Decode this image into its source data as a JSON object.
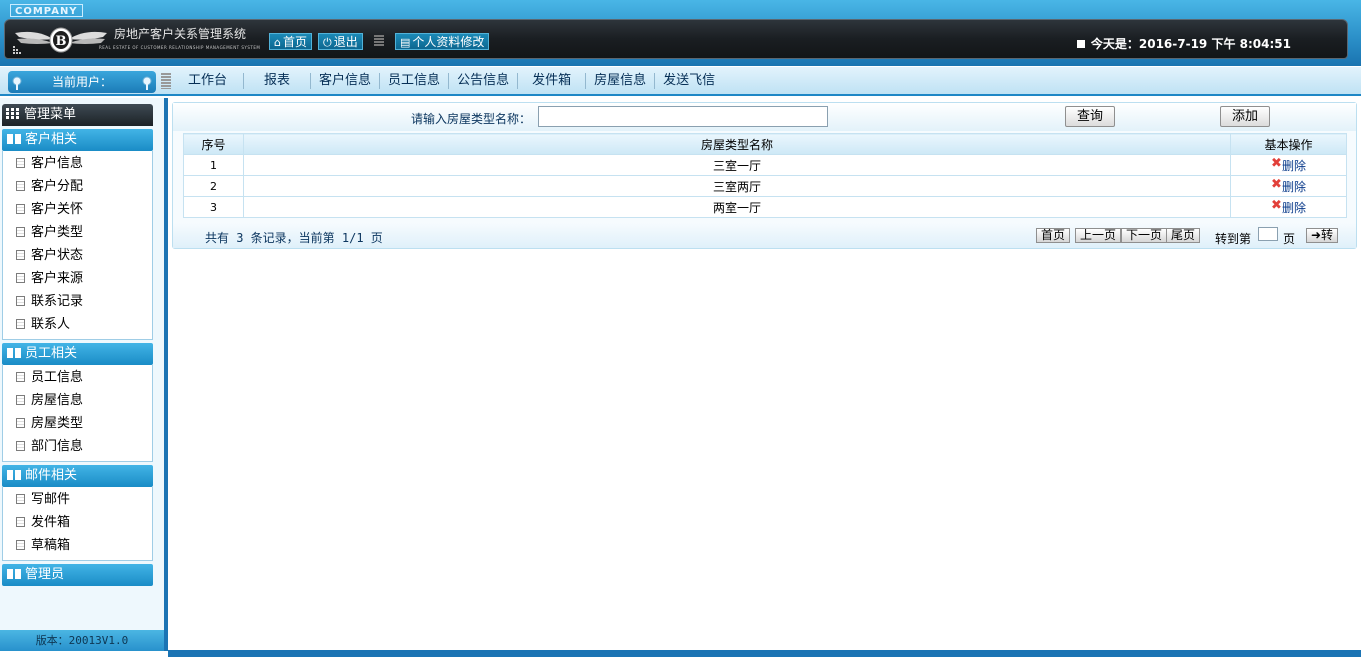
{
  "header": {
    "company_tag": "COMPANY",
    "system_title": "房地产客户关系管理系统",
    "system_subtitle": "REAL ESTATE OF CUSTOMER RELATIONSHIP MANAGEMENT SYSTEM",
    "home_label": "首页",
    "logout_label": "退出",
    "profile_label": "个人资料修改",
    "date_text": "今天是：2016-7-19 下午 8:04:51",
    "icons": {
      "home": "home-icon",
      "logout": "power-icon",
      "profile": "document-icon"
    }
  },
  "nav": {
    "current_user_label": "当前用户：",
    "items": [
      "工作台",
      "报表",
      "客户信息",
      "员工信息",
      "公告信息",
      "发件箱",
      "房屋信息",
      "发送飞信"
    ]
  },
  "sidebar": {
    "menu_title": "管理菜单",
    "groups": [
      {
        "title": "客户相关",
        "items": [
          "客户信息",
          "客户分配",
          "客户关怀",
          "客户类型",
          "客户状态",
          "客户来源",
          "联系记录",
          "联系人"
        ]
      },
      {
        "title": "员工相关",
        "items": [
          "员工信息",
          "房屋信息",
          "房屋类型",
          "部门信息"
        ]
      },
      {
        "title": "邮件相关",
        "items": [
          "写邮件",
          "发件箱",
          "草稿箱"
        ]
      },
      {
        "title": "管理员",
        "items": []
      }
    ],
    "version": "版本：20013V1.0"
  },
  "search": {
    "label": "请输入房屋类型名称：",
    "value": "",
    "query_label": "查询",
    "add_label": "添加"
  },
  "table": {
    "headers": [
      "序号",
      "房屋类型名称",
      "基本操作"
    ],
    "rows": [
      {
        "index": "1",
        "name": "三室一厅",
        "action": "删除"
      },
      {
        "index": "2",
        "name": "三室两厅",
        "action": "删除"
      },
      {
        "index": "3",
        "name": "两室一厅",
        "action": "删除"
      }
    ]
  },
  "pagination": {
    "record_info": "共有 3 条记录，当前第 1/1 页",
    "first": "首页",
    "prev": "上一页",
    "next": "下一页",
    "last": "尾页",
    "goto_label": "转到第",
    "goto_value": "",
    "goto_unit": "页",
    "go_label": "➜转"
  },
  "colors": {
    "accent": "#1b74b4",
    "header_dark": "#1a1e22",
    "delete_icon": "#e2403a"
  }
}
